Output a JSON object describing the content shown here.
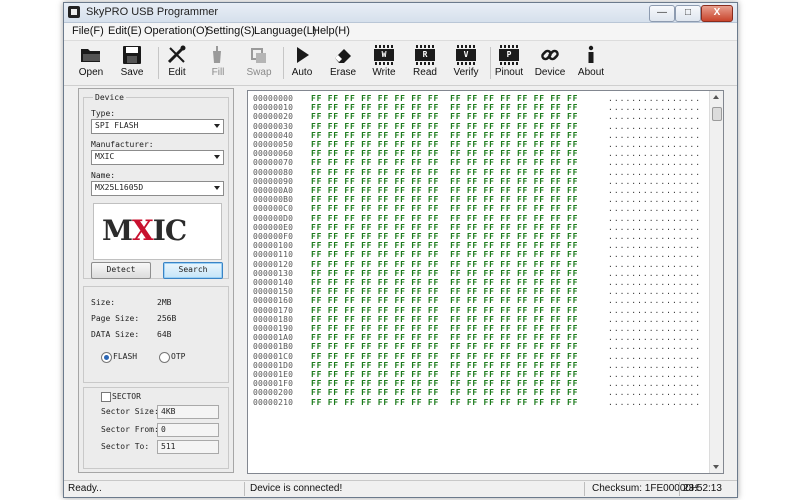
{
  "window": {
    "title": "SkyPRO USB Programmer"
  },
  "titlebar_buttons": {
    "minimize": "—",
    "maximize": "□",
    "close": "X"
  },
  "menu": [
    "File(F)",
    "Edit(E)",
    "Operation(O)",
    "Setting(S)",
    "Language(L)",
    "Help(H)"
  ],
  "toolbar": [
    {
      "label": "Open",
      "icon": "folder-icon",
      "enabled": true
    },
    {
      "label": "Save",
      "icon": "floppy-disk-icon",
      "enabled": true
    },
    {
      "label": "Edit",
      "icon": "tools-icon",
      "enabled": true
    },
    {
      "label": "Fill",
      "icon": "paint-bucket-icon",
      "enabled": false
    },
    {
      "label": "Swap",
      "icon": "swap-icon",
      "enabled": false
    },
    {
      "label": "Auto",
      "icon": "play-icon",
      "enabled": true
    },
    {
      "label": "Erase",
      "icon": "eraser-icon",
      "enabled": true
    },
    {
      "label": "Write",
      "icon": "chip-icon",
      "chip_letter": "W",
      "enabled": true
    },
    {
      "label": "Read",
      "icon": "chip-icon",
      "chip_letter": "R",
      "enabled": true
    },
    {
      "label": "Verify",
      "icon": "chip-icon",
      "chip_letter": "V",
      "enabled": true
    },
    {
      "label": "Pinout",
      "icon": "chip-icon",
      "chip_letter": "P",
      "enabled": true
    },
    {
      "label": "Device",
      "icon": "link-icon",
      "enabled": true
    },
    {
      "label": "About",
      "icon": "info-icon",
      "enabled": true
    }
  ],
  "device": {
    "group_label": "Device",
    "type_label": "Type:",
    "type_value": "SPI FLASH",
    "manufacturer_label": "Manufacturer:",
    "manufacturer_value": "MXIC",
    "name_label": "Name:",
    "name_value": "MX25L1605D",
    "logo_text_a": "M",
    "logo_text_x": "X",
    "logo_text_b": "IC",
    "detect_label": "Detect",
    "search_label": "Search"
  },
  "info": {
    "size_label": "Size:",
    "size_value": "2MB",
    "page_size_label": "Page Size:",
    "page_size_value": "256B",
    "data_size_label": "DATA Size:",
    "data_size_value": "64B",
    "flash_label": "FLASH",
    "otp_label": "OTP",
    "selected_mode": "FLASH"
  },
  "sector": {
    "checkbox_label": "SECTOR",
    "checked": false,
    "size_label": "Sector Size:",
    "size_value": "4KB",
    "from_label": "Sector From:",
    "from_value": "0",
    "to_label": "Sector To:",
    "to_value": "511"
  },
  "hex": {
    "rows": [
      {
        "addr": "00000000",
        "bytes": "FF FF FF FF FF FF FF FF  FF FF FF FF FF FF FF FF",
        "ascii": "................"
      },
      {
        "addr": "00000010",
        "bytes": "FF FF FF FF FF FF FF FF  FF FF FF FF FF FF FF FF",
        "ascii": "................"
      },
      {
        "addr": "00000020",
        "bytes": "FF FF FF FF FF FF FF FF  FF FF FF FF FF FF FF FF",
        "ascii": "................"
      },
      {
        "addr": "00000030",
        "bytes": "FF FF FF FF FF FF FF FF  FF FF FF FF FF FF FF FF",
        "ascii": "................"
      },
      {
        "addr": "00000040",
        "bytes": "FF FF FF FF FF FF FF FF  FF FF FF FF FF FF FF FF",
        "ascii": "................"
      },
      {
        "addr": "00000050",
        "bytes": "FF FF FF FF FF FF FF FF  FF FF FF FF FF FF FF FF",
        "ascii": "................"
      },
      {
        "addr": "00000060",
        "bytes": "FF FF FF FF FF FF FF FF  FF FF FF FF FF FF FF FF",
        "ascii": "................"
      },
      {
        "addr": "00000070",
        "bytes": "FF FF FF FF FF FF FF FF  FF FF FF FF FF FF FF FF",
        "ascii": "................"
      },
      {
        "addr": "00000080",
        "bytes": "FF FF FF FF FF FF FF FF  FF FF FF FF FF FF FF FF",
        "ascii": "................"
      },
      {
        "addr": "00000090",
        "bytes": "FF FF FF FF FF FF FF FF  FF FF FF FF FF FF FF FF",
        "ascii": "................"
      },
      {
        "addr": "000000A0",
        "bytes": "FF FF FF FF FF FF FF FF  FF FF FF FF FF FF FF FF",
        "ascii": "................"
      },
      {
        "addr": "000000B0",
        "bytes": "FF FF FF FF FF FF FF FF  FF FF FF FF FF FF FF FF",
        "ascii": "................"
      },
      {
        "addr": "000000C0",
        "bytes": "FF FF FF FF FF FF FF FF  FF FF FF FF FF FF FF FF",
        "ascii": "................"
      },
      {
        "addr": "000000D0",
        "bytes": "FF FF FF FF FF FF FF FF  FF FF FF FF FF FF FF FF",
        "ascii": "................"
      },
      {
        "addr": "000000E0",
        "bytes": "FF FF FF FF FF FF FF FF  FF FF FF FF FF FF FF FF",
        "ascii": "................"
      },
      {
        "addr": "000000F0",
        "bytes": "FF FF FF FF FF FF FF FF  FF FF FF FF FF FF FF FF",
        "ascii": "................"
      },
      {
        "addr": "00000100",
        "bytes": "FF FF FF FF FF FF FF FF  FF FF FF FF FF FF FF FF",
        "ascii": "................"
      },
      {
        "addr": "00000110",
        "bytes": "FF FF FF FF FF FF FF FF  FF FF FF FF FF FF FF FF",
        "ascii": "................"
      },
      {
        "addr": "00000120",
        "bytes": "FF FF FF FF FF FF FF FF  FF FF FF FF FF FF FF FF",
        "ascii": "................"
      },
      {
        "addr": "00000130",
        "bytes": "FF FF FF FF FF FF FF FF  FF FF FF FF FF FF FF FF",
        "ascii": "................"
      },
      {
        "addr": "00000140",
        "bytes": "FF FF FF FF FF FF FF FF  FF FF FF FF FF FF FF FF",
        "ascii": "................"
      },
      {
        "addr": "00000150",
        "bytes": "FF FF FF FF FF FF FF FF  FF FF FF FF FF FF FF FF",
        "ascii": "................"
      },
      {
        "addr": "00000160",
        "bytes": "FF FF FF FF FF FF FF FF  FF FF FF FF FF FF FF FF",
        "ascii": "................"
      },
      {
        "addr": "00000170",
        "bytes": "FF FF FF FF FF FF FF FF  FF FF FF FF FF FF FF FF",
        "ascii": "................"
      },
      {
        "addr": "00000180",
        "bytes": "FF FF FF FF FF FF FF FF  FF FF FF FF FF FF FF FF",
        "ascii": "................"
      },
      {
        "addr": "00000190",
        "bytes": "FF FF FF FF FF FF FF FF  FF FF FF FF FF FF FF FF",
        "ascii": "................"
      },
      {
        "addr": "000001A0",
        "bytes": "FF FF FF FF FF FF FF FF  FF FF FF FF FF FF FF FF",
        "ascii": "................"
      },
      {
        "addr": "000001B0",
        "bytes": "FF FF FF FF FF FF FF FF  FF FF FF FF FF FF FF FF",
        "ascii": "................"
      },
      {
        "addr": "000001C0",
        "bytes": "FF FF FF FF FF FF FF FF  FF FF FF FF FF FF FF FF",
        "ascii": "................"
      },
      {
        "addr": "000001D0",
        "bytes": "FF FF FF FF FF FF FF FF  FF FF FF FF FF FF FF FF",
        "ascii": "................"
      },
      {
        "addr": "000001E0",
        "bytes": "FF FF FF FF FF FF FF FF  FF FF FF FF FF FF FF FF",
        "ascii": "................"
      },
      {
        "addr": "000001F0",
        "bytes": "FF FF FF FF FF FF FF FF  FF FF FF FF FF FF FF FF",
        "ascii": "................"
      },
      {
        "addr": "00000200",
        "bytes": "FF FF FF FF FF FF FF FF  FF FF FF FF FF FF FF FF",
        "ascii": "................"
      },
      {
        "addr": "00000210",
        "bytes": "FF FF FF FF FF FF FF FF  FF FF FF FF FF FF FF FF",
        "ascii": "................"
      }
    ]
  },
  "status": {
    "left": "Ready..",
    "middle": "Device is connected!",
    "checksum": "Checksum: 1FE00000H",
    "time": "23:52:13"
  },
  "colors": {
    "hex_bytes": "#1a7a1a",
    "logo_red": "#c8102e",
    "close_button": "#c9442c"
  }
}
